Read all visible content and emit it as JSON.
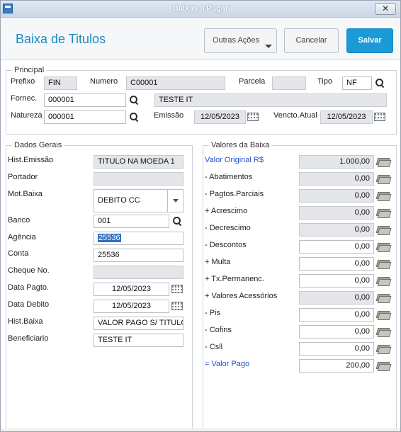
{
  "window": {
    "title": "Baixas a Pagar",
    "close_label": "✕"
  },
  "header": {
    "page_title": "Baixa de Titulos",
    "outras_label": "Outras Ações",
    "cancelar_label": "Cancelar",
    "salvar_label": "Salvar"
  },
  "principal": {
    "legend": "Principal",
    "prefixo_label": "Prefixo",
    "prefixo_value": "FIN",
    "numero_label": "Numero",
    "numero_value": "C00001",
    "parcela_label": "Parcela",
    "parcela_value": "",
    "tipo_label": "Tipo",
    "tipo_value": "NF",
    "fornec_label": "Fornec.",
    "fornec_value": "000001",
    "fornec_name": "TESTE IT",
    "natureza_label": "Natureza",
    "natureza_value": "000001",
    "emissao_label": "Emissão",
    "emissao_value": "12/05/2023",
    "vencto_label": "Vencto.Atual",
    "vencto_value": "12/05/2023"
  },
  "dados_gerais": {
    "legend": "Dados Gerais",
    "hist_emissao_label": "Hist.Emissão",
    "hist_emissao_value": "TITULO NA MOEDA 1",
    "portador_label": "Portador",
    "portador_value": "",
    "mot_baixa_label": "Mot.Baixa",
    "mot_baixa_value": "DEBITO CC",
    "banco_label": "Banco",
    "banco_value": "001",
    "agencia_label": "Agência",
    "agencia_value": "25536",
    "conta_label": "Conta",
    "conta_value": "25536",
    "cheque_label": "Cheque No.",
    "cheque_value": "",
    "data_pagto_label": "Data Pagto.",
    "data_pagto_value": "12/05/2023",
    "data_debito_label": "Data Debito",
    "data_debito_value": "12/05/2023",
    "hist_baixa_label": "Hist.Baixa",
    "hist_baixa_value": "VALOR PAGO S/ TITULO",
    "beneficiario_label": "Beneficiario",
    "beneficiario_value": "TESTE IT"
  },
  "valores": {
    "legend": "Valores da Baixa",
    "rows": [
      {
        "label": "Valor Original R$",
        "value": "1.000,00"
      },
      {
        "label": "- Abatimentos",
        "value": "0,00"
      },
      {
        "label": "- Pagtos.Parciais",
        "value": "0,00"
      },
      {
        "label": "+ Acrescimo",
        "value": "0,00"
      },
      {
        "label": "- Decrescimo",
        "value": "0,00"
      },
      {
        "label": "- Descontos",
        "value": "0,00"
      },
      {
        "label": "+ Multa",
        "value": "0,00"
      },
      {
        "label": "+ Tx.Permanenc.",
        "value": "0,00"
      },
      {
        "label": "+ Valores Acessórios",
        "value": "0,00"
      },
      {
        "label": "- Pis",
        "value": "0,00"
      },
      {
        "label": "- Cofins",
        "value": "0,00"
      },
      {
        "label": "- Csll",
        "value": "0,00"
      },
      {
        "label": "= Valor Pago",
        "value": "200,00"
      }
    ]
  }
}
